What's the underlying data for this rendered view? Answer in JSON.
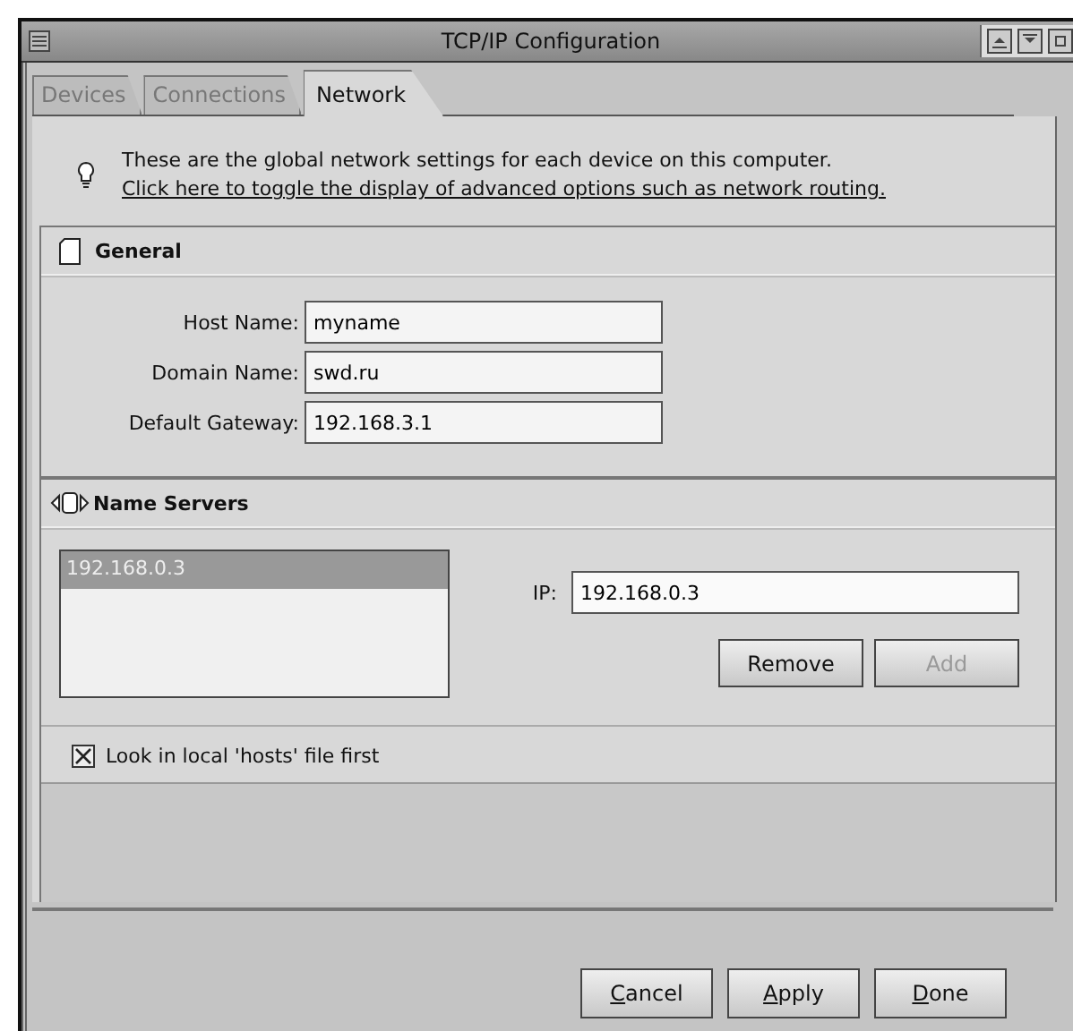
{
  "window": {
    "title": "TCP/IP Configuration"
  },
  "tabs": [
    {
      "label": "Devices",
      "selected": false
    },
    {
      "label": "Connections",
      "selected": false
    },
    {
      "label": "Network",
      "selected": true
    }
  ],
  "info": {
    "text": "These are the global network settings for each device on this computer.",
    "link": "Click here to toggle the display of advanced options such as network routing."
  },
  "general": {
    "title": "General",
    "fields": [
      {
        "label": "Host Name:",
        "value": "myname"
      },
      {
        "label": "Domain Name:",
        "value": "swd.ru"
      },
      {
        "label": "Default Gateway:",
        "value": "192.168.3.1"
      }
    ]
  },
  "name_servers": {
    "title": "Name Servers",
    "list": [
      {
        "label": "192.168.0.3",
        "selected": true
      }
    ],
    "ip_label": "IP:",
    "ip_value": "192.168.0.3",
    "buttons": [
      {
        "label": "Remove",
        "disabled": false
      },
      {
        "label": "Add",
        "disabled": true
      }
    ],
    "hosts_checkbox": {
      "label": "Look in local 'hosts' file first",
      "checked": true
    }
  },
  "footer_buttons": [
    {
      "key": "C",
      "rest": "ancel"
    },
    {
      "key": "A",
      "rest": "pply"
    },
    {
      "key": "D",
      "rest": "one"
    }
  ]
}
